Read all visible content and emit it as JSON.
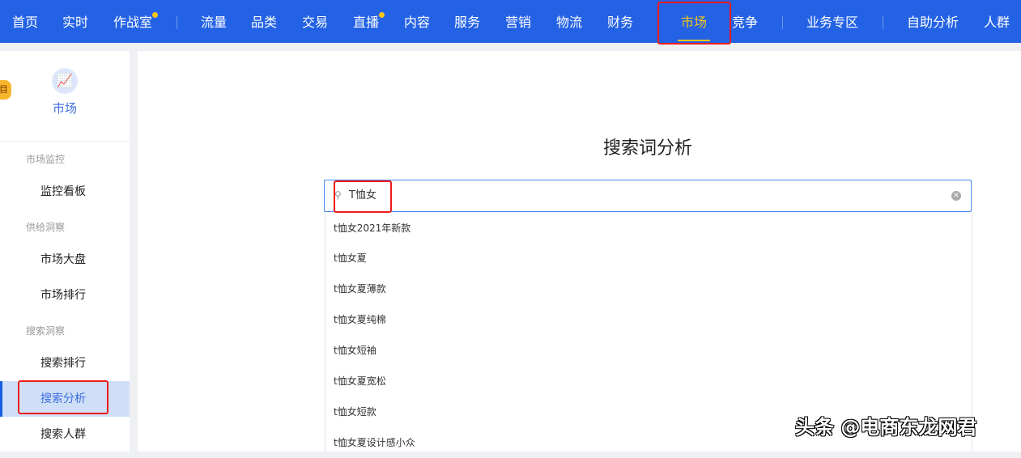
{
  "nav": {
    "items": [
      {
        "label": "首页"
      },
      {
        "label": "实时"
      },
      {
        "label": "作战室"
      },
      {
        "label": "流量"
      },
      {
        "label": "品类"
      },
      {
        "label": "交易"
      },
      {
        "label": "直播"
      },
      {
        "label": "内容"
      },
      {
        "label": "服务"
      },
      {
        "label": "营销"
      },
      {
        "label": "物流"
      },
      {
        "label": "财务"
      },
      {
        "label": "市场"
      },
      {
        "label": "竞争"
      },
      {
        "label": "业务专区"
      },
      {
        "label": "自助分析"
      },
      {
        "label": "人群"
      }
    ],
    "active": "市场"
  },
  "sidebar": {
    "badge": "目",
    "module_label": "市场",
    "groups": [
      {
        "label": "市场监控",
        "items": [
          "监控看板"
        ]
      },
      {
        "label": "供给洞察",
        "items": [
          "市场大盘",
          "市场排行"
        ]
      },
      {
        "label": "搜索洞察",
        "items": [
          "搜索排行",
          "搜索分析",
          "搜索人群"
        ]
      }
    ],
    "active": "搜索分析"
  },
  "main": {
    "title": "搜索词分析",
    "search_value": "T恤女",
    "suggestions": [
      "t恤女2021年新款",
      "t恤女夏",
      "t恤女夏薄款",
      "t恤女夏纯棉",
      "t恤女短袖",
      "t恤女夏宽松",
      "t恤女短款",
      "t恤女夏设计感小众"
    ]
  },
  "watermark": "头条 @电商东龙网君",
  "colors": {
    "nav_bg": "#2462e5",
    "active": "#f5c518",
    "accent": "#3e6de0"
  }
}
